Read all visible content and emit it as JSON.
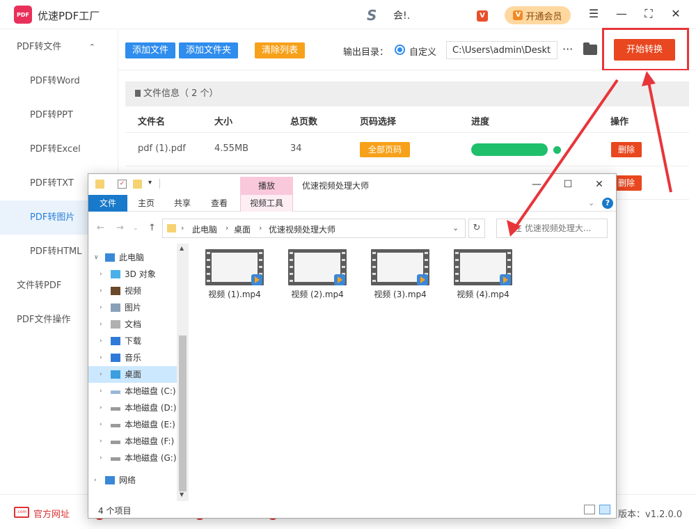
{
  "app": {
    "title": "优速PDF工厂",
    "logo_text": "PDF",
    "user_name": "会!.",
    "vip_badge": "V",
    "vip_label": "开通会员"
  },
  "sidebar": {
    "items": [
      {
        "label": "PDF转文件",
        "kind": "group",
        "expanded": true
      },
      {
        "label": "PDF转Word",
        "kind": "sub"
      },
      {
        "label": "PDF转PPT",
        "kind": "sub"
      },
      {
        "label": "PDF转Excel",
        "kind": "sub"
      },
      {
        "label": "PDF转TXT",
        "kind": "sub"
      },
      {
        "label": "PDF转图片",
        "kind": "sub",
        "active": true
      },
      {
        "label": "PDF转HTML",
        "kind": "sub"
      },
      {
        "label": "文件转PDF",
        "kind": "group"
      },
      {
        "label": "PDF文件操作",
        "kind": "group"
      }
    ]
  },
  "toolbar": {
    "add_file": "添加文件",
    "add_folder": "添加文件夹",
    "clear_list": "清除列表",
    "output_label": "输出目录：",
    "radio_label": "自定义",
    "output_path": "C:\\Users\\admin\\Desktop",
    "more": "···",
    "start": "开始转换"
  },
  "file_list": {
    "header": "文件信息（ 2 个）",
    "columns": [
      "文件名",
      "大小",
      "总页数",
      "页码选择",
      "进度",
      "操作"
    ],
    "rows": [
      {
        "name": "pdf (1).pdf",
        "size": "4.55MB",
        "pages": "34",
        "range": "全部页码",
        "progress": 1.0,
        "action": "删除"
      },
      {
        "name": "",
        "size": "",
        "pages": "",
        "range": "",
        "progress": null,
        "action": "删除"
      }
    ]
  },
  "footer": {
    "site_icon": ".com",
    "site_link": "官方网址",
    "version": "版本：v1.2.0.0"
  },
  "explorer": {
    "context_tab": "播放",
    "window_title": "优速视频处理大师",
    "ribbon_tabs": [
      "文件",
      "主页",
      "共享",
      "查看",
      "视频工具"
    ],
    "breadcrumb": [
      "此电脑",
      "桌面",
      "优速视频处理大师"
    ],
    "search_placeholder": "在 优速视频处理大...",
    "nav_tree": [
      {
        "label": "此电脑",
        "icon": "computer-icon",
        "level": 0,
        "expanded": true
      },
      {
        "label": "3D 对象",
        "icon": "cube-icon",
        "level": 1
      },
      {
        "label": "视频",
        "icon": "video-folder-icon",
        "level": 1
      },
      {
        "label": "图片",
        "icon": "picture-folder-icon",
        "level": 1
      },
      {
        "label": "文档",
        "icon": "document-folder-icon",
        "level": 1
      },
      {
        "label": "下载",
        "icon": "download-arrow-icon",
        "level": 1
      },
      {
        "label": "音乐",
        "icon": "music-note-icon",
        "level": 1
      },
      {
        "label": "桌面",
        "icon": "desktop-folder-icon",
        "level": 1,
        "selected": true
      },
      {
        "label": "本地磁盘 (C:)",
        "icon": "windows-drive-icon",
        "level": 1
      },
      {
        "label": "本地磁盘 (D:)",
        "icon": "drive-icon",
        "level": 1
      },
      {
        "label": "本地磁盘 (E:)",
        "icon": "drive-icon",
        "level": 1
      },
      {
        "label": "本地磁盘 (F:)",
        "icon": "drive-icon",
        "level": 1
      },
      {
        "label": "本地磁盘 (G:)",
        "icon": "drive-icon",
        "level": 1
      },
      {
        "label": "网络",
        "icon": "network-icon",
        "level": 0
      }
    ],
    "files": [
      "视频 (1).mp4",
      "视频 (2).mp4",
      "视频 (3).mp4",
      "视频 (4).mp4"
    ],
    "status": "4 个项目"
  },
  "colors": {
    "brand_blue": "#2f8ded",
    "start_red": "#e8471f",
    "clear_orange": "#f7a11a",
    "progress_green": "#1fbf6c",
    "annotation_red": "#e8353a"
  }
}
